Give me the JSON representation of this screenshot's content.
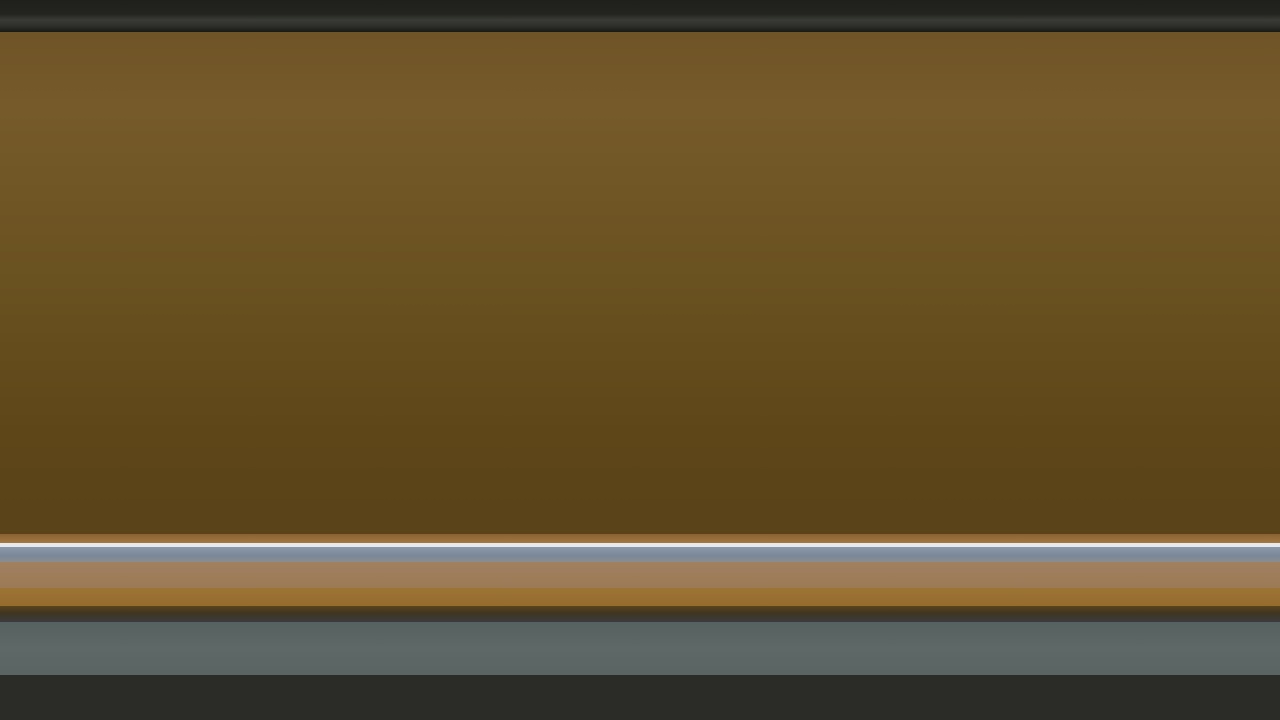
{
  "colors": {
    "top_strip": "#23241f",
    "main_panel": "#6a5120",
    "edge_orange": "#a27844",
    "edge_highlight": "#e6e9ee",
    "stripe_blue": "#7a8799",
    "stripe_tan": "#9c7a56",
    "stripe_amber": "#956c2e",
    "divider_dark": "#3f3522",
    "bar_grey": "#5e6866",
    "bottom_area": "#2b2c28"
  }
}
